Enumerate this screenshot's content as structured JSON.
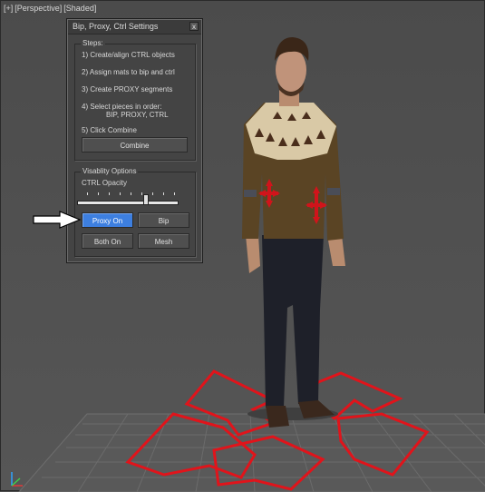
{
  "viewport": {
    "labels": [
      "[+]",
      "[Perspective]",
      "[Shaded]"
    ]
  },
  "panel": {
    "title": "Bip, Proxy, Ctrl Settings",
    "close_label": "x",
    "steps_group": {
      "label": "Steps:",
      "items": [
        "1) Create/align CTRL objects",
        "2) Assign mats to bip and ctrl",
        "3) Create PROXY segments",
        "4) Select pieces in order:",
        "BIP, PROXY, CTRL",
        "5) Click Combine"
      ],
      "combine_label": "Combine"
    },
    "visibility_group": {
      "label": "Visablity Options",
      "slider_label": "CTRL Opacity",
      "slider_value": 0.68,
      "buttons": {
        "proxy_on": "Proxy On",
        "bip": "Bip",
        "both_on": "Both On",
        "mesh": "Mesh"
      },
      "active_button": "proxy_on"
    }
  },
  "colors": {
    "accent_blue": "#3d7fe0",
    "control_red": "#e0141b",
    "panel_bg": "#444444",
    "viewport_bg": "#505050"
  }
}
